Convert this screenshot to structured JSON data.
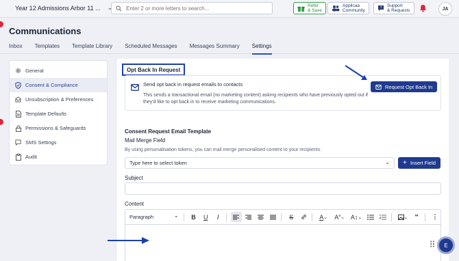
{
  "topbar": {
    "workspace": "Year 12 Admissions Arbor 11 ...",
    "search_placeholder": "Enter 2 or more letters to search...",
    "refer": [
      "Refer",
      "& Save"
    ],
    "community": [
      "Applicaa",
      "Community"
    ],
    "support": [
      "Support",
      "& Requests"
    ],
    "avatar": "JA"
  },
  "page": {
    "title": "Communications",
    "tabs": [
      "Inbox",
      "Templates",
      "Template Library",
      "Scheduled Messages",
      "Messages Summary",
      "Settings"
    ],
    "active_tab": "Settings"
  },
  "menu": {
    "items": [
      {
        "label": "General",
        "icon": "gear-icon"
      },
      {
        "label": "Consent & Compliance",
        "icon": "shield-check-icon"
      },
      {
        "label": "Unsubscription & Preferences",
        "icon": "mail-open-icon"
      },
      {
        "label": "Template Defaults",
        "icon": "document-icon"
      },
      {
        "label": "Permissions & Safeguards",
        "icon": "lock-icon"
      },
      {
        "label": "SMS Settings",
        "icon": "chat-icon"
      },
      {
        "label": "Audit",
        "icon": "clipboard-icon"
      }
    ],
    "active": "Consent & Compliance"
  },
  "opt_back": {
    "section_title": "Opt Back In Request",
    "toggle_label": "Send opt back in request emails to contacts",
    "description": "This sends a transactional email (no marketing content) asking recipients who have previously opted out if they'd like to opt back in to receive marketing communications.",
    "button": "Request Opt Back In"
  },
  "template": {
    "title": "Consent Request Email Template",
    "merge_title": "Mail Merge Field",
    "merge_desc": "By using personalisation tokens, you can mail merge personalised content to your recipients.",
    "token_placeholder": "Type here to select token",
    "insert_button": "Insert Field",
    "subject_label": "Subject",
    "subject_value": "",
    "content_label": "Content",
    "format": "Paragraph"
  },
  "fab_label": "E",
  "colors": {
    "primary": "#1f3a8f",
    "accent_blue": "#2d4eb8",
    "alert": "#e0263a",
    "green": "#35a24b"
  }
}
